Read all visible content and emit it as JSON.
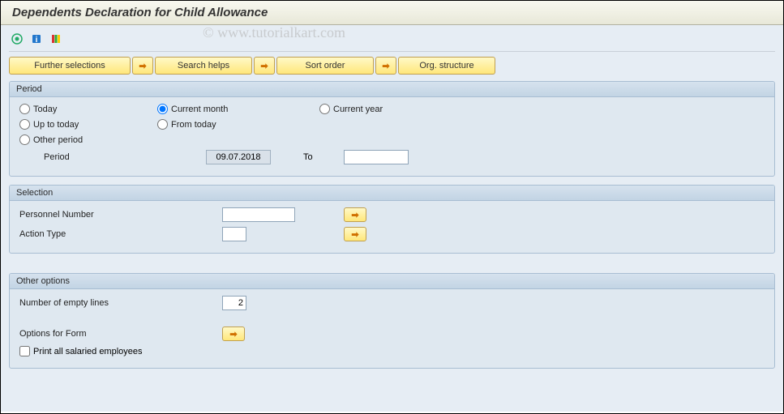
{
  "watermark": "© www.tutorialkart.com",
  "title": "Dependents Declaration for Child Allowance",
  "app_toolbar": {
    "further_selections": "Further selections",
    "search_helps": "Search helps",
    "sort_order": "Sort order",
    "org_structure": "Org. structure"
  },
  "period": {
    "legend": "Period",
    "today": "Today",
    "current_month": "Current month",
    "current_year": "Current year",
    "up_to_today": "Up to today",
    "from_today": "From today",
    "other_period": "Other period",
    "period_label": "Period",
    "period_from_value": "09.07.2018",
    "to_label": "To",
    "period_to_value": "",
    "selected": "current_month"
  },
  "selection": {
    "legend": "Selection",
    "personnel_number_label": "Personnel Number",
    "personnel_number_value": "",
    "action_type_label": "Action Type",
    "action_type_value": ""
  },
  "other_options": {
    "legend": "Other options",
    "empty_lines_label": "Number of empty lines",
    "empty_lines_value": "2",
    "options_form_label": "Options for Form",
    "print_all_label": "Print all salaried employees",
    "print_all_checked": false
  }
}
